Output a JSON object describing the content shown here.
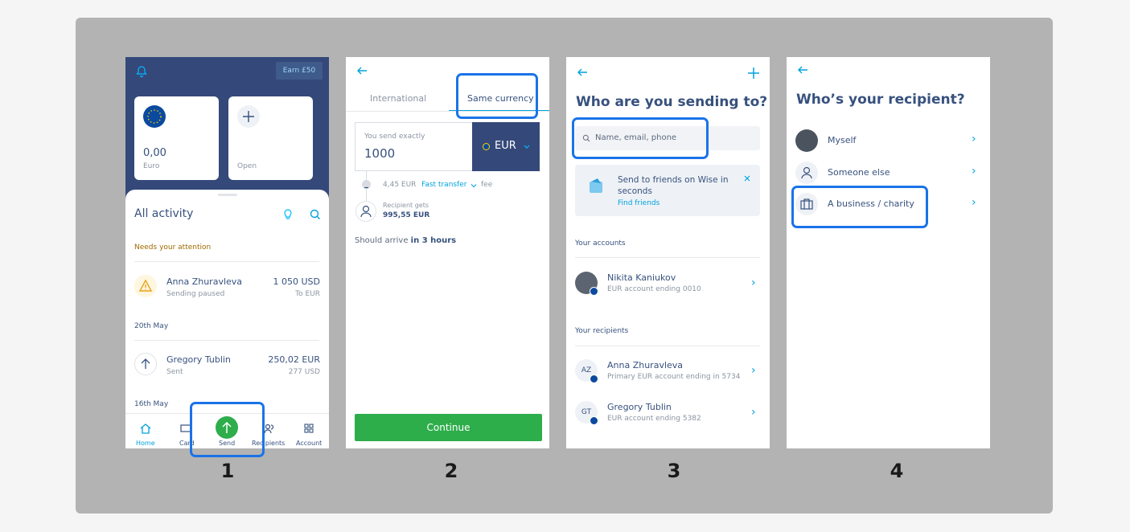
{
  "steps": [
    "1",
    "2",
    "3",
    "4"
  ],
  "icons": {
    "bell": "bell-icon",
    "back": "arrow-left-icon",
    "plus": "plus-icon",
    "search": "search-icon",
    "bulb": "lightbulb-icon",
    "warning": "warning-icon",
    "up": "arrow-up-icon",
    "close": "close-icon",
    "chevron": "chevron-right-icon",
    "person": "person-icon",
    "briefcase": "briefcase-icon"
  },
  "colors": {
    "navy": "#34497a",
    "accent_blue": "#00a2dd",
    "green": "#2ead4b",
    "highlight": "#1a73e8",
    "warning": "#e8a318"
  },
  "screen1": {
    "earn_button": "Earn £50",
    "balance_value": "0,00",
    "balance_currency": "Euro",
    "open_label": "Open",
    "heading": "All activity",
    "attention_label": "Needs your attention",
    "items": [
      {
        "name": "Anna Zhuravleva",
        "status": "Sending paused",
        "amount": "1 050 USD",
        "sub": "To EUR"
      },
      {
        "name": "Gregory Tublin",
        "status": "Sent",
        "amount": "250,02 EUR",
        "sub": "277 USD"
      }
    ],
    "date1": "20th May",
    "date2": "16th May",
    "tabs": [
      "Home",
      "Card",
      "Send",
      "Recipients",
      "Account"
    ]
  },
  "screen2": {
    "tab_international": "International",
    "tab_same": "Same currency",
    "send_label": "You send exactly",
    "send_value": "1000",
    "currency": "EUR",
    "fee_amount": "4,45 EUR",
    "fee_type": "Fast transfer",
    "fee_word": "fee",
    "recipient_label": "Recipient gets",
    "recipient_value": "995,55 EUR",
    "arrive_text": "Should arrive",
    "arrive_time": "in 3 hours",
    "continue": "Continue"
  },
  "screen3": {
    "title": "Who are you sending to?",
    "search_placeholder": "Name, email, phone",
    "promo_title": "Send to friends on Wise in seconds",
    "promo_link": "Find friends",
    "accounts_label": "Your accounts",
    "account": {
      "name": "Nikita Kaniukov",
      "sub": "EUR account ending 0010"
    },
    "recipients_label": "Your recipients",
    "recipients": [
      {
        "initials": "AZ",
        "name": "Anna Zhuravleva",
        "sub": "Primary EUR account ending in 5734"
      },
      {
        "initials": "GT",
        "name": "Gregory Tublin",
        "sub": "EUR account ending 5382"
      }
    ]
  },
  "screen4": {
    "title": "Who’s your recipient?",
    "options": [
      "Myself",
      "Someone else",
      "A business / charity"
    ]
  }
}
